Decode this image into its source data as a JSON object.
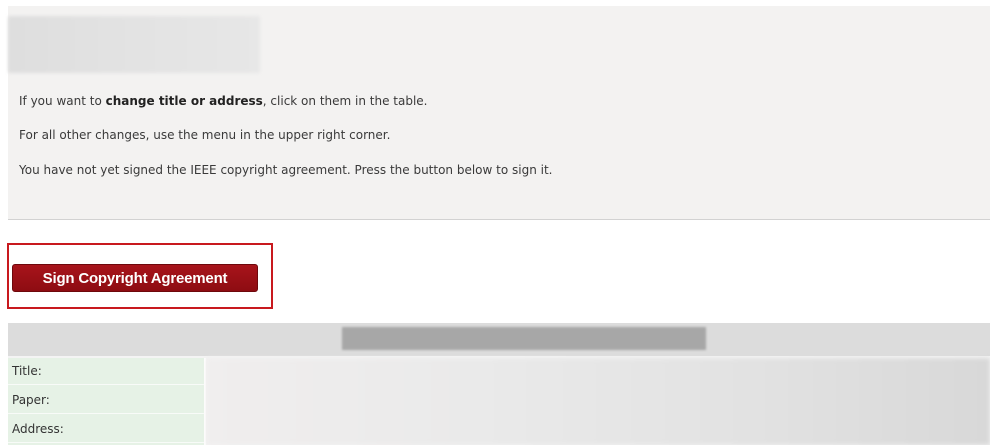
{
  "info": {
    "line1_prefix": "If you want to ",
    "line1_bold": "change title or address",
    "line1_suffix": ", click on them in the table.",
    "line2": "For all other changes, use the menu in the upper right corner.",
    "line3": "You have not yet signed the IEEE copyright agreement. Press the button below to sign it."
  },
  "actions": {
    "sign_button_label": "Sign Copyright Agreement"
  },
  "details": {
    "rows": [
      {
        "label": "Title:"
      },
      {
        "label": "Paper:"
      },
      {
        "label": "Address:"
      }
    ]
  },
  "colors": {
    "button_bg": "#9b1016",
    "highlight_border": "#c8191e",
    "label_bg": "#e6f2e6",
    "panel_bg": "#f3f2f1"
  }
}
